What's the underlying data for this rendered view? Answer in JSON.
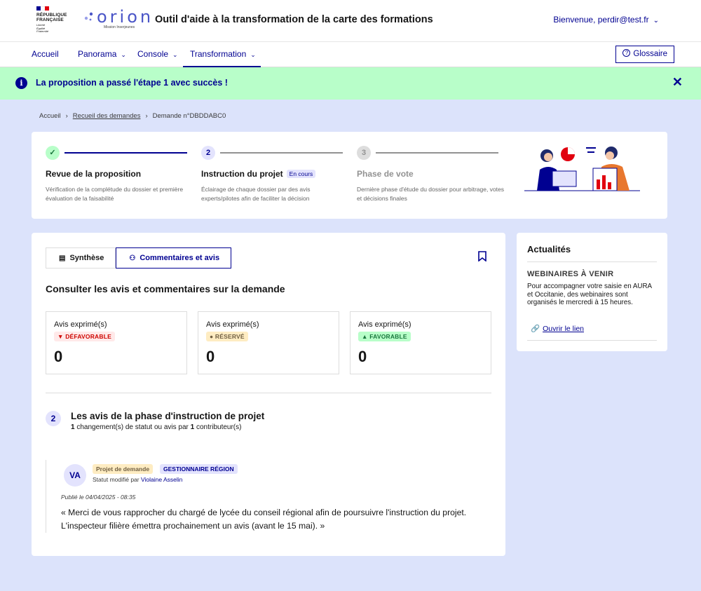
{
  "header": {
    "republique_lines": [
      "RÉPUBLIQUE",
      "FRANÇAISE"
    ],
    "devise_lines": [
      "Liberté",
      "Égalité",
      "Fraternité"
    ],
    "logo_word": "orion",
    "logo_sub": "Mission Inserjeunes",
    "site_title": "Outil d'aide à la transformation de la carte des formations",
    "user_label": "Bienvenue, perdir@test.fr",
    "flag_colors": [
      "#000091",
      "#ffffff",
      "#e1000f"
    ]
  },
  "nav": {
    "items": [
      {
        "label": "Accueil",
        "dropdown": false
      },
      {
        "label": "Panorama",
        "dropdown": true
      },
      {
        "label": "Console",
        "dropdown": true
      },
      {
        "label": "Transformation",
        "dropdown": true,
        "active": true
      }
    ],
    "glossaire_label": "Glossaire"
  },
  "alert": {
    "message": "La proposition a passé l'étape 1 avec succès !",
    "color": "#b8fec9"
  },
  "breadcrumb": {
    "items": [
      "Accueil",
      "Recueil des demandes",
      "Demande n°DBDDABC0"
    ]
  },
  "stepper": {
    "steps": [
      {
        "number": "✓",
        "title": "Revue de la proposition",
        "badge": "",
        "description": "Vérification de la complétude du dossier et première évaluation de la faisabilité",
        "state": "done"
      },
      {
        "number": "2",
        "title": "Instruction du projet",
        "badge": "En cours",
        "description": "Éclairage de chaque dossier par des avis experts/pilotes afin de faciliter la décision",
        "state": "current"
      },
      {
        "number": "3",
        "title": "Phase de vote",
        "badge": "",
        "description": "Dernière phase d'étude du dossier pour arbitrage, votes et décisions finales",
        "state": "upcoming"
      }
    ]
  },
  "main": {
    "tabs": [
      {
        "label": "Synthèse",
        "icon": "document-icon",
        "active": false
      },
      {
        "label": "Commentaires et avis",
        "icon": "people-icon",
        "active": true
      }
    ],
    "section_title": "Consulter les avis et commentaires sur la demande",
    "stats": [
      {
        "label": "Avis exprimé(s)",
        "badge": "DÉFAVORABLE",
        "icon": "thumbs-down-icon",
        "value": "0",
        "badge_bg": "#ffe9e9",
        "badge_fg": "#ce0500"
      },
      {
        "label": "Avis exprimé(s)",
        "badge": "RÉSERVÉ",
        "icon": "neutral-icon",
        "value": "0",
        "badge_bg": "#feecc2",
        "badge_fg": "#716043"
      },
      {
        "label": "Avis exprimé(s)",
        "badge": "FAVORABLE",
        "icon": "thumbs-up-icon",
        "value": "0",
        "badge_bg": "#b8fec9",
        "badge_fg": "#18753c"
      }
    ],
    "phase": {
      "number": "2",
      "title": "Les avis de la phase d'instruction de projet",
      "changes_count": "1",
      "changes_text": " changement(s) de statut ou avis par ",
      "contributors_count": "1",
      "contributors_text": " contributeur(s)"
    },
    "entry": {
      "avatar": "VA",
      "tag_project": "Projet de demande",
      "tag_role": "GESTIONNAIRE RÉGION",
      "status_prefix": "Statut modifié par ",
      "author": "Violaine Asselin",
      "published": "Publié le 04/04/2025 - 08:35",
      "comment": "« Merci de vous rapprocher du chargé de lycée du conseil régional afin de poursuivre l'instruction du projet. L'inspecteur filière émettra prochainement un avis (avant le 15 mai). »"
    }
  },
  "news": {
    "title": "Actualités",
    "heading": "WEBINAIRES À VENIR",
    "body": "Pour accompagner votre saisie en AURA et Occitanie, des webinaires sont organisés le mercredi à 15 heures.",
    "link": "Ouvrir le lien"
  }
}
